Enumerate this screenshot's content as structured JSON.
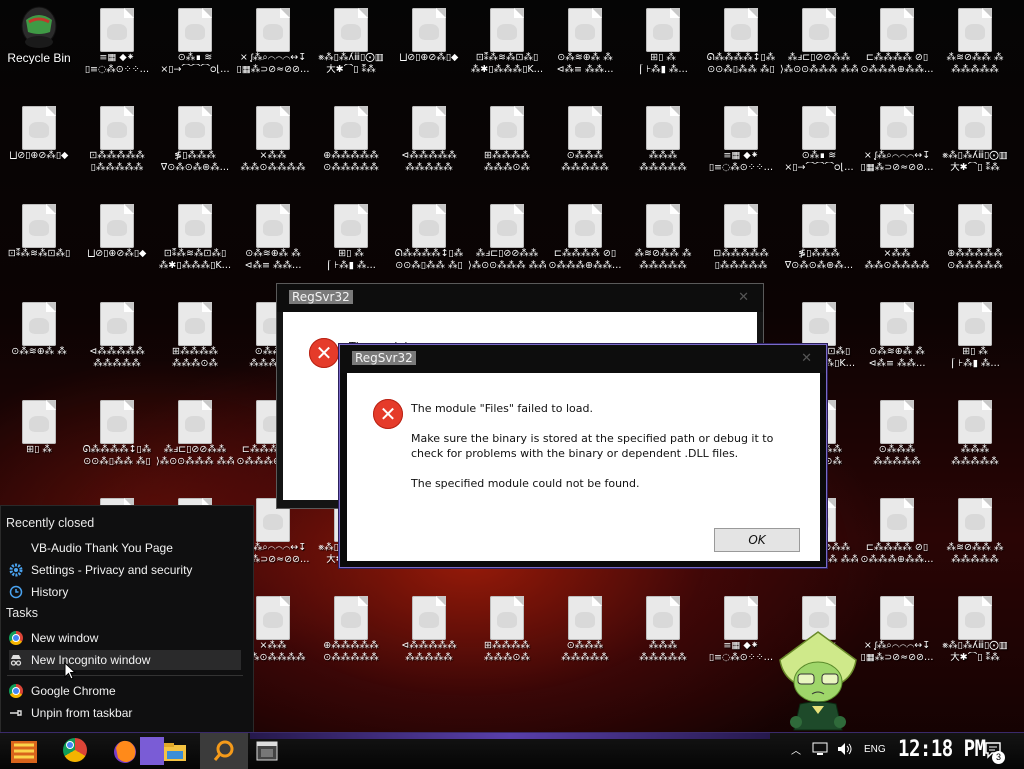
{
  "desktop": {
    "recycle_bin_label": "Recycle Bin",
    "file_icons": [
      {
        "l1": "≡▦ ◆⁕",
        "l2": "▯≡◌⁂⊙⁘⁘…"
      },
      {
        "l1": "⊙⁂∎ ≋",
        "l2": "⨯▯→⌒⌒⌒ᴑ⌊…"
      },
      {
        "l1": "⨯ ᶘ⁂⌕⌒⌒⌒↔↧",
        "l2": "▯▦⁂⊃⊘≈⊘⊘…"
      },
      {
        "l1": "⨳⁂▯⁂ʎⅲ▯⨀▥",
        "l2": "大✱⌒▯ ⁑⁂"
      },
      {
        "l1": "⨆⊘▯⊕⊘⁂▯◆",
        "l2": ""
      },
      {
        "l1": "⊡⁑⁂≋⁂⊡⁂▯",
        "l2": "⁂✱▯⁂⁂⁂▯K…"
      },
      {
        "l1": "⊙⁂≋⊕⁂ ⁂",
        "l2": "⊲⁂≡ ⁂⁂…"
      },
      {
        "l1": "⊞▯ ⁂",
        "l2": "⌠ ⊦⁂▮ ⁂…"
      },
      {
        "l1": "ᘏ⁂⁂⁂⁂↕▯⁂",
        "l2": "⊙⊙⁂▯⁂⁂ ⁂▯"
      },
      {
        "l1": "⁂ⅎ⊏▯⊘⊘⁂⁂",
        "l2": "⟩⁂⊙⊙⁂⁂⁂ ⁂⁂"
      },
      {
        "l1": "⊏⁂⁂⁂⁂ ⊘▯",
        "l2": "⊙⁂⁂⁂⊕⁂⁂…"
      },
      {
        "l1": "⁂≋⊘⁂⁂ ⁂",
        "l2": "⁂⁂⁂⁂⁂"
      },
      {
        "l1": "⊡⁂⁂⁂⁂⁂",
        "l2": "▯⁂⁂⁂⁂⁂"
      },
      {
        "l1": "≸▯⁂⁂⁂",
        "l2": "∇⊙⁂⊙⁂⊛⁂…"
      },
      {
        "l1": "⨯⁂⁂",
        "l2": "⁂⁂⊙⁂⁂⁂⁂"
      },
      {
        "l1": "⊕⁂⁂⁂⁂⁂",
        "l2": "⊙⁂⁂⁂⁂⁂"
      },
      {
        "l1": "⊲⁂⁂⁂⁂⁂",
        "l2": "⁂⁂⁂⁂⁂"
      },
      {
        "l1": "⊞⁂⁂⁂⁂",
        "l2": "⁂⁂⁂⊙⁂"
      },
      {
        "l1": "⊙⁂⁂⁂",
        "l2": "⁂⁂⁂⁂⁂"
      },
      {
        "l1": "⁂⁂⁂",
        "l2": "⁂⁂⁂⁂⁂"
      }
    ]
  },
  "dialog_back": {
    "title": "RegSvr32",
    "close": "✕",
    "partial_text": "The module \"Files\" failed to load."
  },
  "dialog_front": {
    "title": "RegSvr32",
    "close": "✕",
    "line1": "The module \"Files\" failed to load.",
    "line2": "Make sure the binary is stored at the specified path or debug it to check for problems with the binary or dependent .DLL files.",
    "line3": "The specified module could not be found.",
    "ok_label": "OK"
  },
  "jumplist": {
    "recently_closed_header": "Recently closed",
    "recent": [
      {
        "label": "VB-Audio Thank You Page",
        "icon": "blank-page-icon"
      },
      {
        "label": "Settings - Privacy and security",
        "icon": "gear-icon"
      },
      {
        "label": "History",
        "icon": "history-icon"
      }
    ],
    "tasks_header": "Tasks",
    "tasks": [
      {
        "label": "New window",
        "icon": "chrome-icon"
      },
      {
        "label": "New Incognito window",
        "icon": "incognito-icon"
      }
    ],
    "pinned": [
      {
        "label": "Google Chrome",
        "icon": "chrome-icon"
      },
      {
        "label": "Unpin from taskbar",
        "icon": "unpin-icon"
      }
    ]
  },
  "taskbar": {
    "apps": [
      "start-icon",
      "chrome-icon",
      "firefox-icon",
      "file-explorer-icon",
      "search-icon",
      "app-window-icon"
    ],
    "language": "ENG",
    "clock": "12:18 PM",
    "notification_count": "3",
    "colors": {
      "accent": "#6a4ad0",
      "error": "#e53b2a"
    }
  }
}
